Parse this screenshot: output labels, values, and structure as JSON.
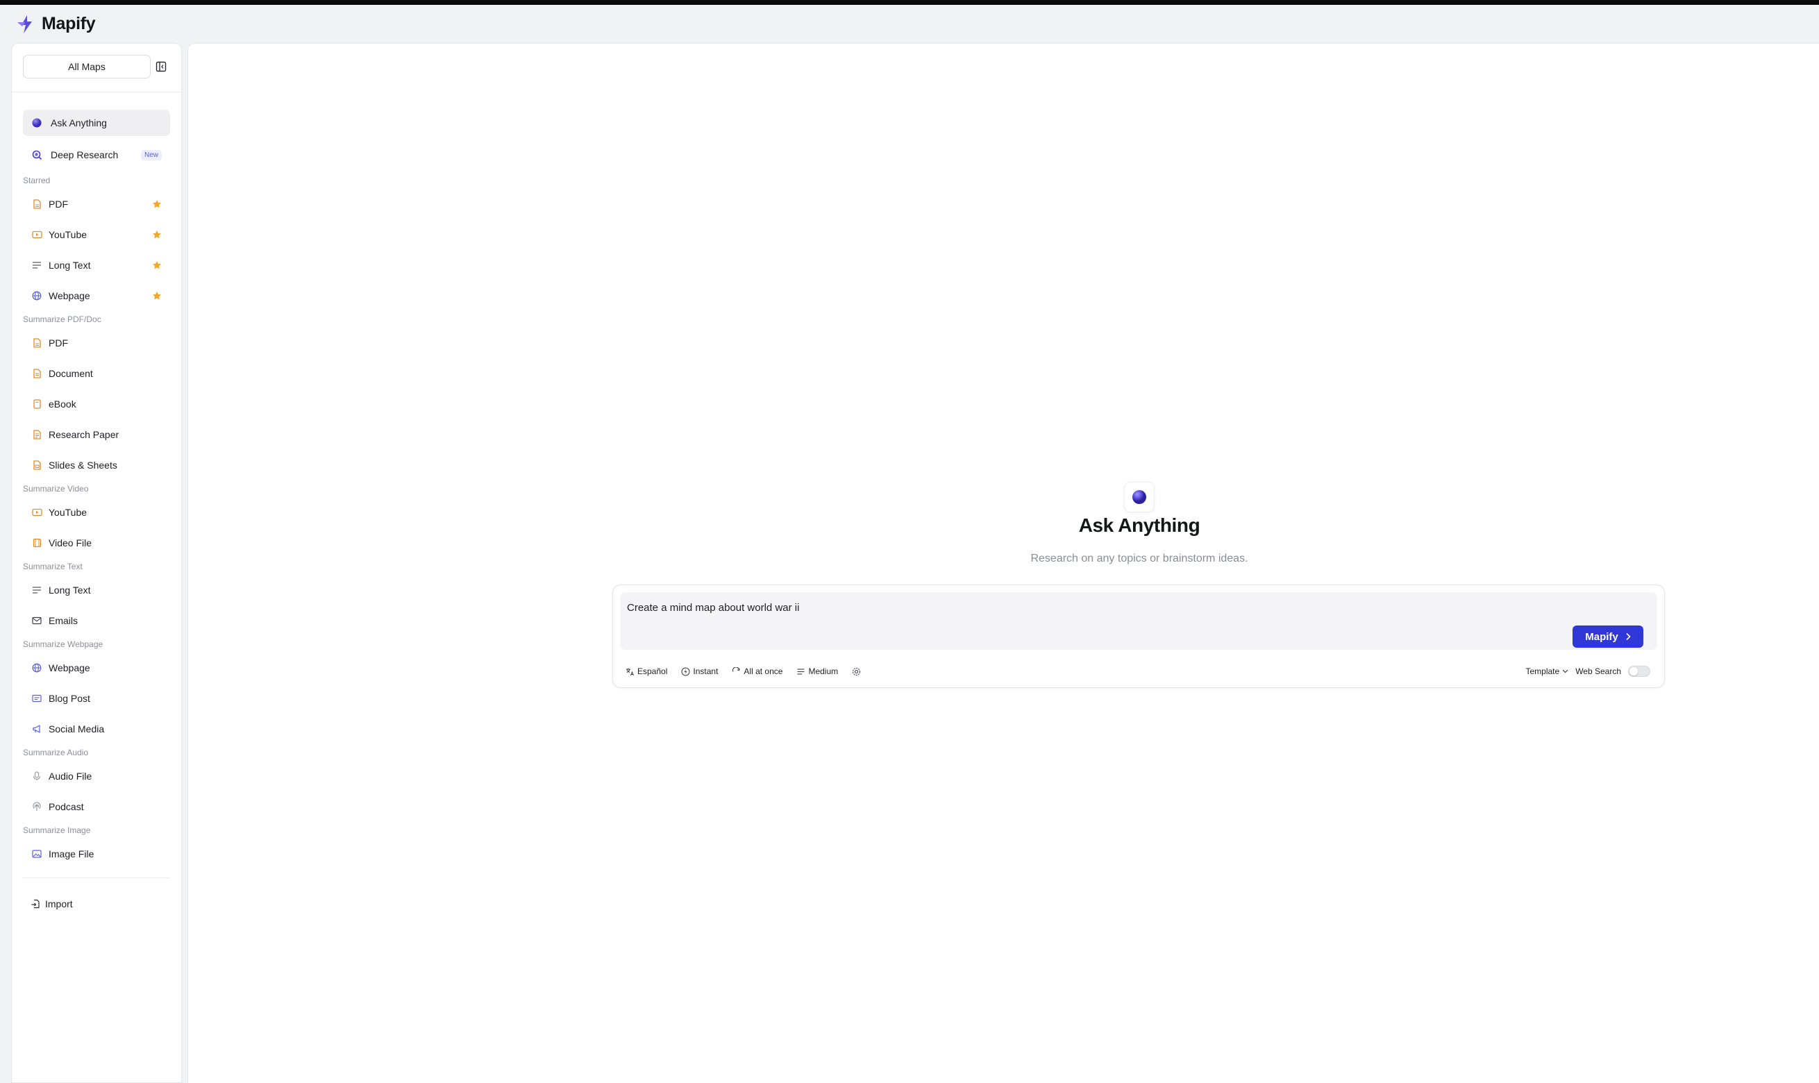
{
  "app": {
    "name": "Mapify",
    "brand_color": "#2f37d6"
  },
  "sidebar": {
    "all_maps_label": "All Maps",
    "main_items": [
      {
        "label": "Ask Anything",
        "icon": "sphere-icon",
        "active": true
      },
      {
        "label": "Deep Research",
        "icon": "research-icon",
        "badge": "New"
      }
    ],
    "sections": [
      {
        "title": "Starred",
        "items": [
          {
            "label": "PDF",
            "icon": "pdf-icon",
            "starred": true
          },
          {
            "label": "YouTube",
            "icon": "youtube-icon",
            "starred": true
          },
          {
            "label": "Long Text",
            "icon": "text-lines-icon",
            "starred": true
          },
          {
            "label": "Webpage",
            "icon": "globe-icon",
            "starred": true
          }
        ]
      },
      {
        "title": "Summarize PDF/Doc",
        "items": [
          {
            "label": "PDF",
            "icon": "pdf-icon"
          },
          {
            "label": "Document",
            "icon": "document-icon"
          },
          {
            "label": "eBook",
            "icon": "ebook-icon"
          },
          {
            "label": "Research Paper",
            "icon": "paper-icon"
          },
          {
            "label": "Slides & Sheets",
            "icon": "slides-icon"
          }
        ]
      },
      {
        "title": "Summarize Video",
        "items": [
          {
            "label": "YouTube",
            "icon": "youtube-icon"
          },
          {
            "label": "Video File",
            "icon": "film-icon"
          }
        ]
      },
      {
        "title": "Summarize Text",
        "items": [
          {
            "label": "Long Text",
            "icon": "text-lines-icon"
          },
          {
            "label": "Emails",
            "icon": "mail-icon"
          }
        ]
      },
      {
        "title": "Summarize Webpage",
        "items": [
          {
            "label": "Webpage",
            "icon": "globe-icon"
          },
          {
            "label": "Blog Post",
            "icon": "blog-icon"
          },
          {
            "label": "Social Media",
            "icon": "megaphone-icon"
          }
        ]
      },
      {
        "title": "Summarize Audio",
        "items": [
          {
            "label": "Audio File",
            "icon": "mic-icon"
          },
          {
            "label": "Podcast",
            "icon": "podcast-icon"
          }
        ]
      },
      {
        "title": "Summarize Image",
        "items": [
          {
            "label": "Image File",
            "icon": "image-icon"
          }
        ]
      }
    ],
    "import_label": "Import"
  },
  "main": {
    "title": "Ask Anything",
    "subtitle": "Research on any topics or brainstorm ideas.",
    "prompt_value": "Create a mind map about world war ii",
    "submit_label": "Mapify",
    "options": {
      "language": "Español",
      "mode": "Instant",
      "generation": "All at once",
      "length": "Medium",
      "template": "Template",
      "web_search_label": "Web Search",
      "web_search_enabled": false
    }
  }
}
